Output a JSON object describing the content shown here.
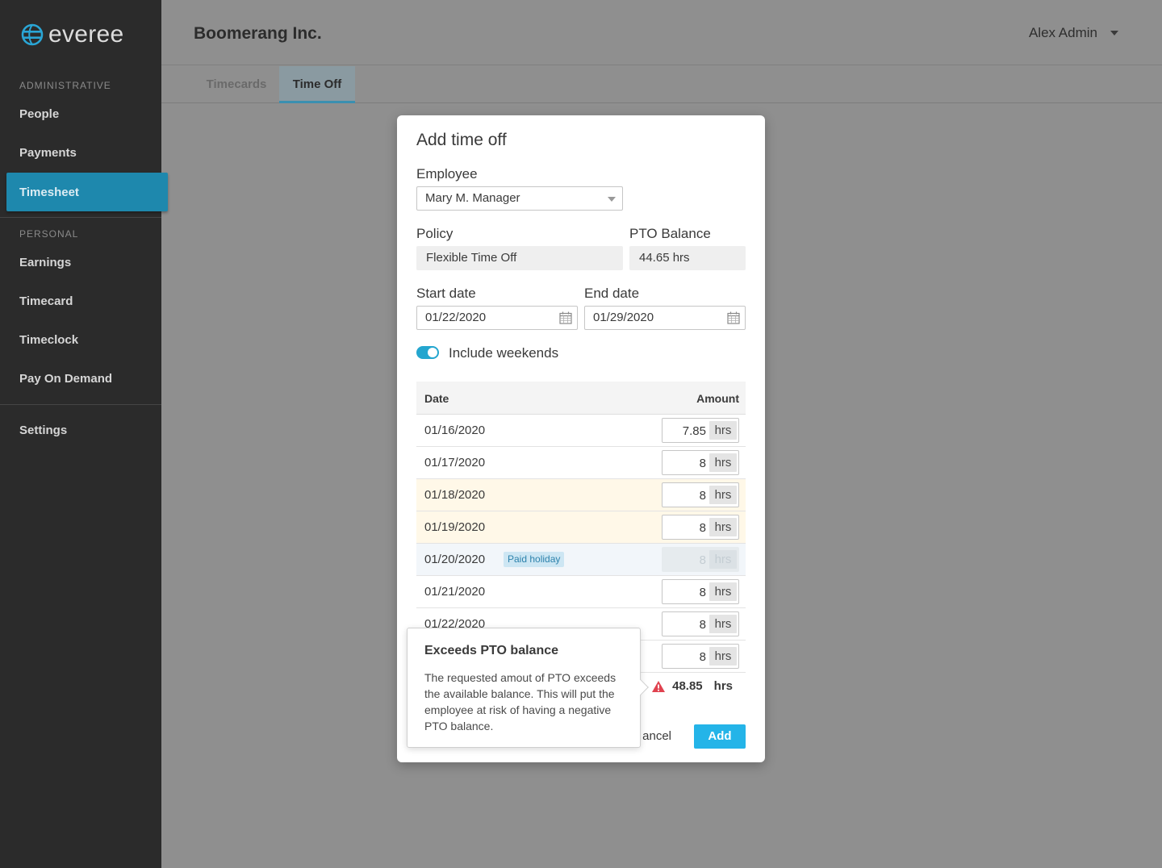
{
  "app": {
    "logo_text": "everee"
  },
  "sidebar": {
    "sections": [
      {
        "label": "ADMINISTRATIVE",
        "items": [
          "People",
          "Payments",
          "Timesheet"
        ]
      },
      {
        "label": "PERSONAL",
        "items": [
          "Earnings",
          "Timecard",
          "Timeclock",
          "Pay On Demand"
        ]
      }
    ],
    "active_item": "Timesheet",
    "settings_label": "Settings"
  },
  "header": {
    "company": "Boomerang Inc.",
    "user": "Alex Admin"
  },
  "tabs": [
    {
      "label": "Timecards",
      "active": false
    },
    {
      "label": "Time Off",
      "active": true
    }
  ],
  "modal": {
    "title": "Add time off",
    "employee_label": "Employee",
    "employee_value": "Mary M. Manager",
    "policy_label": "Policy",
    "policy_value": "Flexible Time Off",
    "balance_label": "PTO Balance",
    "balance_value": "44.65 hrs",
    "start_label": "Start date",
    "start_value": "01/22/2020",
    "end_label": "End date",
    "end_value": "01/29/2020",
    "weekends_label": "Include weekends",
    "weekends_on": true,
    "table": {
      "col_date": "Date",
      "col_amount": "Amount",
      "unit": "hrs",
      "rows": [
        {
          "date": "01/16/2020",
          "amount": "7.85"
        },
        {
          "date": "01/17/2020",
          "amount": "8"
        },
        {
          "date": "01/18/2020",
          "amount": "8",
          "weekend": true
        },
        {
          "date": "01/19/2020",
          "amount": "8",
          "weekend": true
        },
        {
          "date": "01/20/2020",
          "amount": "8",
          "holiday": "Paid holiday"
        },
        {
          "date": "01/21/2020",
          "amount": "8"
        },
        {
          "date": "01/22/2020",
          "amount": "8"
        },
        {
          "date": "",
          "amount": "8"
        }
      ]
    },
    "total_value": "48.85",
    "total_unit": "hrs",
    "cancel_label": "ancel",
    "add_label": "Add"
  },
  "tooltip": {
    "title": "Exceeds PTO balance",
    "body": "The requested amout of PTO exceeds the available balance. This will put the employee at risk of having a negative PTO balance."
  },
  "colors": {
    "accent": "#24b4e8",
    "sidebar": "#2b2b2b",
    "warning": "#e0424f"
  }
}
